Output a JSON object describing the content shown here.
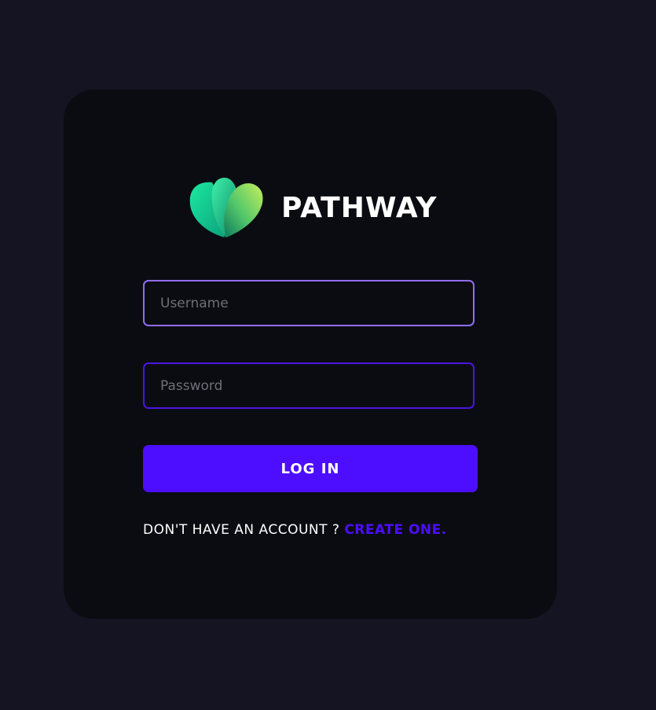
{
  "brand": {
    "name": "PATHWAY",
    "logo_icon": "leaf-logo-icon"
  },
  "form": {
    "username_placeholder": "Username",
    "password_placeholder": "Password",
    "login_label": "LOG IN"
  },
  "signup": {
    "prompt": "DON'T HAVE AN ACCOUNT ? ",
    "link_label": "CREATE ONE."
  },
  "colors": {
    "page_background": "#141422",
    "card_background": "#0b0c12",
    "accent": "#4d0dff",
    "focused_border": "#8f6ef0"
  }
}
